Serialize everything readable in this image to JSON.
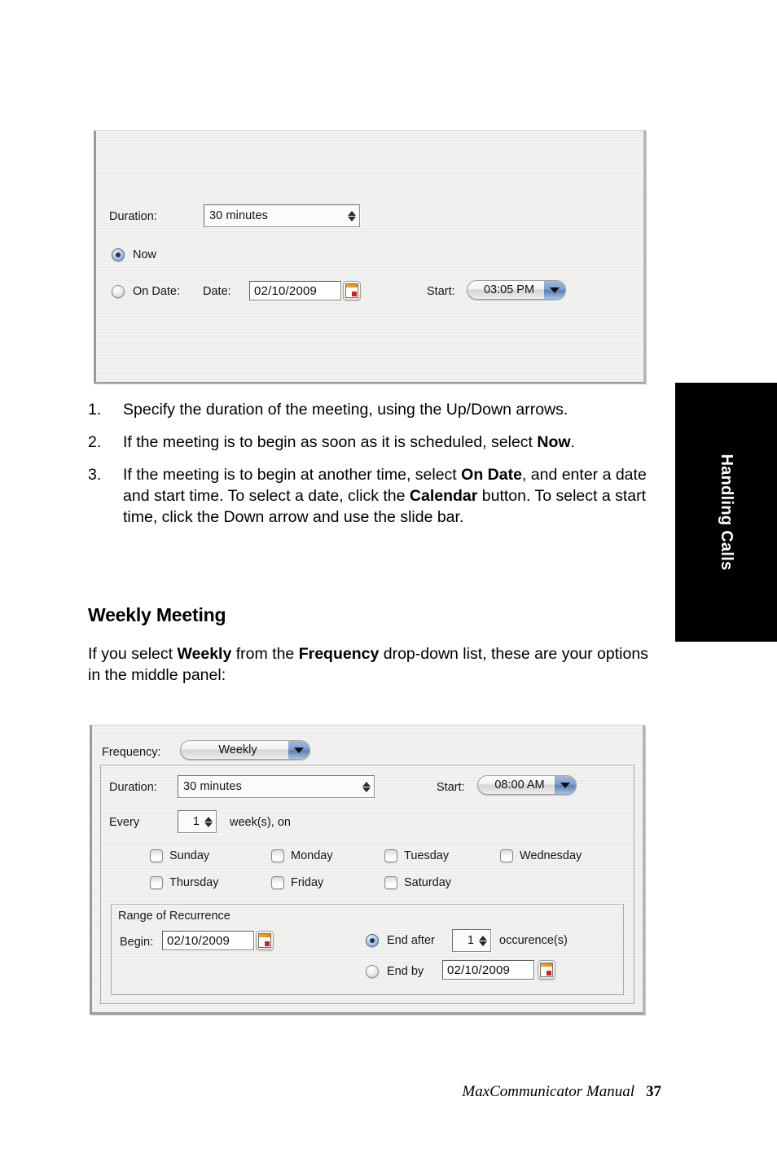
{
  "page": {
    "footer_title": "MaxCommunicator Manual",
    "footer_page": "37",
    "side_tab": "Handling Calls",
    "section_heading": "Weekly Meeting"
  },
  "steps": [
    {
      "num": "1.",
      "text": "Specify the duration of the meeting, using the Up/Down arrows."
    },
    {
      "num": "2.",
      "text_pre": "If the meeting is to begin as soon as it is scheduled, select ",
      "bold1": "Now",
      "text_post": "."
    },
    {
      "num": "3.",
      "text_pre": "If the meeting is to begin at another time, select ",
      "bold1": "On Date",
      "text_mid": ", and enter a date and start time. To select a date, click the ",
      "bold2": "Calendar",
      "text_post": " button. To select a start time, click the Down arrow and use the slide bar."
    }
  ],
  "intro": {
    "pre": "If you select ",
    "bold1": "Weekly",
    "mid": " from the ",
    "bold2": "Frequency",
    "post": " drop-down list, these are your options in the middle panel:"
  },
  "dialog_now": {
    "duration_label": "Duration:",
    "duration_value": "30 minutes",
    "now_label": "Now",
    "on_date_label": "On Date:",
    "date_label": "Date:",
    "date_value": "02/10/2009",
    "start_label": "Start:",
    "start_value": "03:05 PM",
    "calendar_icon": "calendar-icon",
    "now_selected": "true"
  },
  "dialog_weekly": {
    "frequency_label": "Frequency:",
    "frequency_value": "Weekly",
    "duration_label": "Duration:",
    "duration_value": "30 minutes",
    "start_label": "Start:",
    "start_value": "08:00 AM",
    "every_label": "Every",
    "every_value": "1",
    "weeks_label": "week(s), on",
    "days": [
      "Sunday",
      "Monday",
      "Tuesday",
      "Wednesday",
      "Thursday",
      "Friday",
      "Saturday"
    ],
    "range_title": "Range of Recurrence",
    "begin_label": "Begin:",
    "begin_value": "02/10/2009",
    "end_after_label": "End after",
    "end_after_value": "1",
    "occurrences_label": "occurence(s)",
    "end_by_label": "End by",
    "end_by_value": "02/10/2009"
  },
  "colors": {
    "accent_blue": "#5b7fb5",
    "radio_selected": "#16365e",
    "calendar_orange": "#e08f13",
    "calendar_red": "#d02020",
    "tab_black": "#000000"
  }
}
